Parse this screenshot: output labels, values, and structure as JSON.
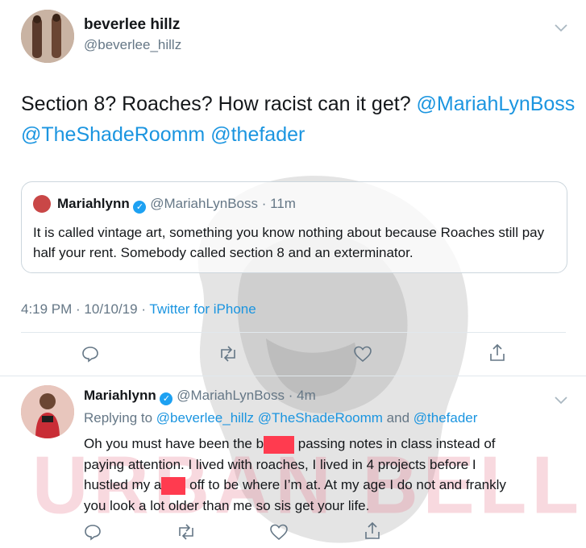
{
  "tweet": {
    "author_name": "beverlee hillz",
    "author_handle": "@beverlee_hillz",
    "text_plain": "Section 8? Roaches? How racist can it get? ",
    "mention_1": "@MariahLynBoss",
    "mention_2": "@TheShadeRoomm",
    "mention_3": "@thefader",
    "meta_time": "4:19 PM · 10/10/19 · ",
    "meta_source": "Twitter for iPhone"
  },
  "quote": {
    "author_name": "Mariahlynn",
    "author_handle": "@MariahLynBoss",
    "time": "· 11m",
    "text": "It is called vintage art, something you know nothing about because Roaches still pay half your rent. Somebody called section 8 and an exterminator."
  },
  "reply": {
    "author_name": "Mariahlynn",
    "author_handle": "@MariahLynBoss",
    "time": "· 4m",
    "replying_prefix": "Replying to ",
    "replying_1": "@beverlee_hillz",
    "replying_2": "@TheShadeRoomm",
    "replying_and": " and ",
    "replying_3": "@thefader",
    "line1_a": "Oh you must have been the b",
    "line1_b": " passing notes in class instead of",
    "line2": "paying attention. I lived with roaches, I lived in 4 projects before I",
    "line3_a": "hustled my a",
    "line3_b": " off to be where I’m at. At my age I do not and frankly",
    "line4": "you look a lot older than me so sis get your life."
  },
  "watermark": {
    "text": "URBAN BELLE"
  },
  "icons": [
    "reply-icon",
    "retweet-icon",
    "like-icon",
    "share-icon",
    "chevron-down-icon",
    "verified-icon"
  ],
  "colors": {
    "link": "#1b95e0",
    "verified": "#1da1f2",
    "muted": "#657786",
    "redaction": "#ff3b4f"
  }
}
